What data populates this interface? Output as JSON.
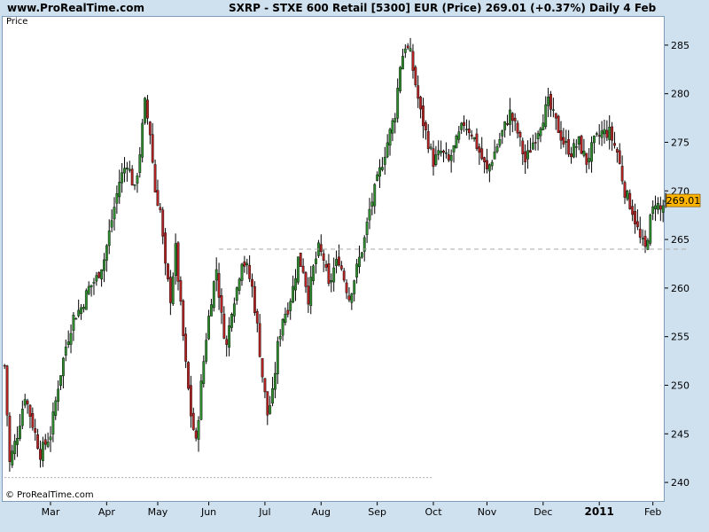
{
  "header": {
    "site": "www.ProRealTime.com",
    "title": "SXRP - STXE 600 Retail [5300] EUR (Price)    269.01 (+0.37%)    Daily  4 Feb"
  },
  "panel_label": "Price",
  "copyright": "© ProRealTime.com",
  "colors": {
    "up": "#2e8b2e",
    "down": "#b22222",
    "background": "#cfe0ef",
    "last_price_tag": "#ffb400"
  },
  "chart_data": {
    "type": "candlestick",
    "ylim": [
      238,
      288
    ],
    "y_ticks": [
      240,
      245,
      250,
      255,
      260,
      265,
      270,
      275,
      280,
      285
    ],
    "x_ticks": [
      {
        "label": "Mar",
        "day": 0
      },
      {
        "label": "Apr",
        "day": 22
      },
      {
        "label": "May",
        "day": 42
      },
      {
        "label": "Jun",
        "day": 62
      },
      {
        "label": "Jul",
        "day": 84
      },
      {
        "label": "Aug",
        "day": 106
      },
      {
        "label": "Sep",
        "day": 128
      },
      {
        "label": "Oct",
        "day": 150
      },
      {
        "label": "Nov",
        "day": 171
      },
      {
        "label": "Dec",
        "day": 193
      },
      {
        "label": "2011",
        "day": 215
      },
      {
        "label": "Feb",
        "day": 236
      }
    ],
    "last_price": 269.01,
    "reference_lines": [
      {
        "value": 264,
        "style": "dashed",
        "from_day": 66,
        "to_day": 249
      },
      {
        "value": 240.5,
        "style": "dotted",
        "from_day": -18,
        "to_day": 150
      }
    ],
    "close_path": [
      [
        -18,
        252
      ],
      [
        -16,
        242
      ],
      [
        -13,
        245
      ],
      [
        -10,
        249
      ],
      [
        -7,
        246
      ],
      [
        -4,
        243
      ],
      [
        0,
        245
      ],
      [
        3,
        250
      ],
      [
        6,
        254
      ],
      [
        9,
        257
      ],
      [
        12,
        258
      ],
      [
        15,
        260
      ],
      [
        18,
        261
      ],
      [
        21,
        263
      ],
      [
        24,
        267
      ],
      [
        27,
        271
      ],
      [
        30,
        273
      ],
      [
        33,
        270
      ],
      [
        35,
        274
      ],
      [
        37,
        279
      ],
      [
        39,
        276
      ],
      [
        41,
        270
      ],
      [
        43,
        268
      ],
      [
        45,
        262
      ],
      [
        47,
        259
      ],
      [
        49,
        264
      ],
      [
        51,
        258
      ],
      [
        53,
        252
      ],
      [
        55,
        247
      ],
      [
        57,
        244
      ],
      [
        59,
        250
      ],
      [
        61,
        255
      ],
      [
        63,
        259
      ],
      [
        65,
        262
      ],
      [
        67,
        257
      ],
      [
        69,
        254
      ],
      [
        71,
        258
      ],
      [
        73,
        260
      ],
      [
        75,
        263
      ],
      [
        77,
        262
      ],
      [
        79,
        260
      ],
      [
        81,
        256
      ],
      [
        83,
        251
      ],
      [
        85,
        247
      ],
      [
        87,
        249
      ],
      [
        89,
        254
      ],
      [
        91,
        257
      ],
      [
        93,
        258
      ],
      [
        95,
        260
      ],
      [
        97,
        263
      ],
      [
        99,
        262
      ],
      [
        101,
        259
      ],
      [
        103,
        262
      ],
      [
        105,
        264
      ],
      [
        107,
        263
      ],
      [
        109,
        260
      ],
      [
        111,
        262
      ],
      [
        113,
        263
      ],
      [
        115,
        261
      ],
      [
        117,
        259
      ],
      [
        119,
        261
      ],
      [
        121,
        263
      ],
      [
        123,
        265
      ],
      [
        125,
        268
      ],
      [
        127,
        270
      ],
      [
        129,
        272
      ],
      [
        131,
        274
      ],
      [
        133,
        276
      ],
      [
        135,
        278
      ],
      [
        137,
        283
      ],
      [
        139,
        285
      ],
      [
        141,
        284
      ],
      [
        143,
        281
      ],
      [
        145,
        278
      ],
      [
        147,
        276
      ],
      [
        150,
        273
      ],
      [
        153,
        274
      ],
      [
        156,
        273
      ],
      [
        159,
        275
      ],
      [
        162,
        277
      ],
      [
        165,
        276
      ],
      [
        168,
        274
      ],
      [
        171,
        272
      ],
      [
        174,
        274
      ],
      [
        177,
        276
      ],
      [
        180,
        278
      ],
      [
        183,
        276
      ],
      [
        186,
        273
      ],
      [
        189,
        275
      ],
      [
        192,
        277
      ],
      [
        195,
        279
      ],
      [
        198,
        277
      ],
      [
        201,
        275
      ],
      [
        204,
        274
      ],
      [
        207,
        275
      ],
      [
        210,
        273
      ],
      [
        213,
        275
      ],
      [
        216,
        276
      ],
      [
        219,
        276
      ],
      [
        222,
        274
      ],
      [
        225,
        270
      ],
      [
        228,
        268
      ],
      [
        231,
        265
      ],
      [
        233,
        264
      ],
      [
        235,
        267
      ],
      [
        237,
        269
      ],
      [
        239,
        268
      ],
      [
        241,
        269.01
      ]
    ]
  }
}
